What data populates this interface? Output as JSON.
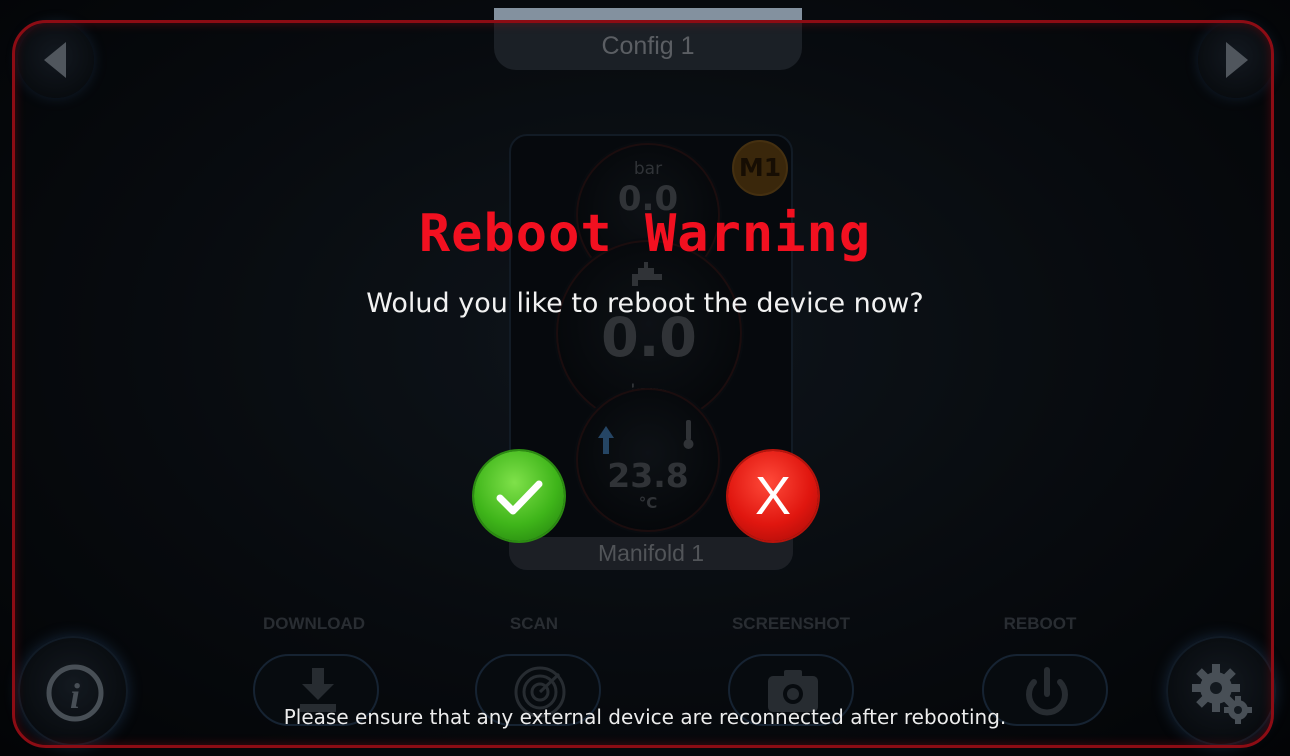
{
  "header": {
    "config_tab": "Config 1"
  },
  "manifold": {
    "badge": "M1",
    "pressure": {
      "unit": "bar",
      "value": "0.0"
    },
    "flow": {
      "value": "0.0",
      "unit": "lpm"
    },
    "temperature": {
      "value": "23.8",
      "unit": "°C"
    },
    "footer": "Manifold 1"
  },
  "toolbar": {
    "download_label": "DOWNLOAD",
    "scan_label": "SCAN",
    "screenshot_label": "SCREENSHOT",
    "reboot_label": "REBOOT"
  },
  "dialog": {
    "title": "Reboot Warning",
    "message": "Wolud you like to reboot the device now?",
    "cancel_glyph": "X",
    "notice": "Please ensure that any external device are reconnected after rebooting."
  },
  "colors": {
    "frame_border": "#d8131f",
    "title": "#f21020",
    "confirm_button": "#3fb51a",
    "cancel_button": "#e0160f",
    "badge": "#5a3d12"
  },
  "icons": {
    "nav_left": "triangle-left-icon",
    "nav_right": "triangle-right-icon",
    "confirm": "checkmark-icon",
    "download": "download-icon",
    "scan": "radar-icon",
    "screenshot": "camera-icon",
    "reboot": "power-icon",
    "info": "info-icon",
    "settings": "gear-icon"
  }
}
